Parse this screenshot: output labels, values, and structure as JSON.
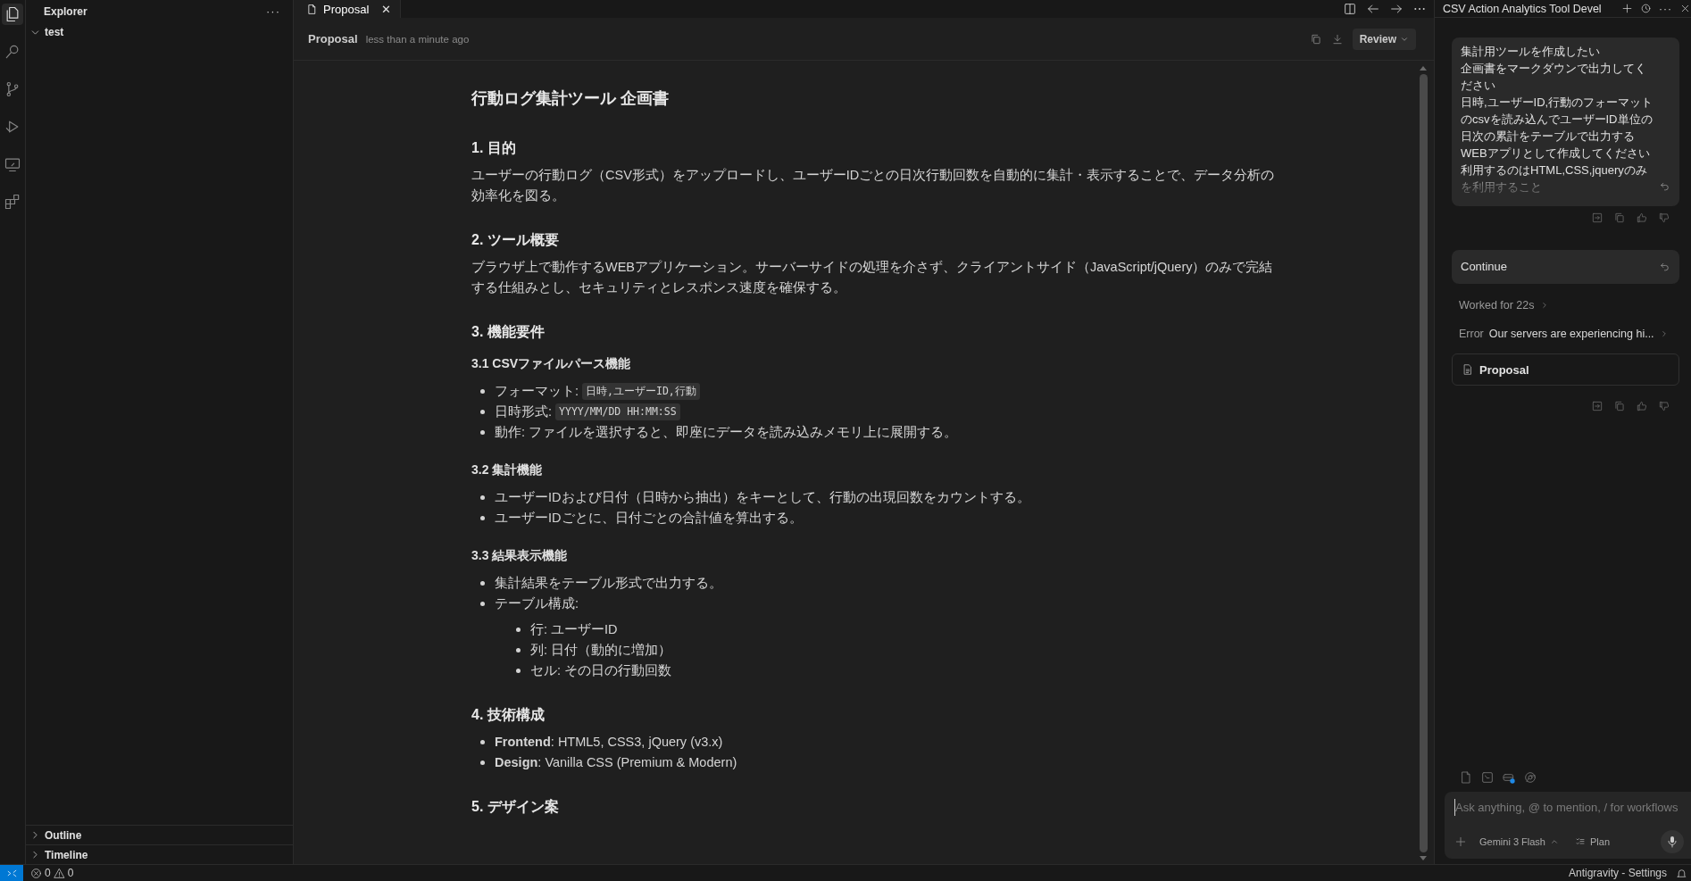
{
  "activity_bar": {
    "items": [
      {
        "kind": "files",
        "selected": true
      },
      {
        "kind": "search",
        "selected": false
      },
      {
        "kind": "branch",
        "selected": false
      },
      {
        "kind": "run",
        "selected": false
      },
      {
        "kind": "remote",
        "selected": false
      },
      {
        "kind": "extensions",
        "selected": false
      }
    ]
  },
  "sidebar": {
    "title": "Explorer",
    "more": "···",
    "folder": {
      "label": "test",
      "expanded": true
    },
    "sections": [
      {
        "label": "Outline",
        "expanded": false
      },
      {
        "label": "Timeline",
        "expanded": false
      }
    ]
  },
  "editor": {
    "tabs": [
      {
        "label": "Proposal",
        "selected": true,
        "close": "✕"
      }
    ],
    "header": {
      "title": "Proposal",
      "subtitle": "less than a minute ago",
      "button": "Review"
    },
    "document": [
      {
        "kind": "h1",
        "text": "行動ログ集計ツール 企画書"
      },
      {
        "kind": "h2",
        "text": "1. 目的"
      },
      {
        "kind": "p",
        "text": "ユーザーの行動ログ（CSV形式）をアップロードし、ユーザーIDごとの日次行動回数を自動的に集計・表示することで、データ分析の効率化を図る。"
      },
      {
        "kind": "h2",
        "text": "2. ツール概要"
      },
      {
        "kind": "p",
        "text": "ブラウザ上で動作するWEBアプリケーション。サーバーサイドの処理を介さず、クライアントサイド（JavaScript/jQuery）のみで完結する仕組みとし、セキュリティとレスポンス速度を確保する。"
      },
      {
        "kind": "h2",
        "text": "3. 機能要件"
      },
      {
        "kind": "h3",
        "text": "3.1 CSVファイルパース機能"
      },
      {
        "kind": "ul",
        "items": [
          {
            "text": "フォーマット: ",
            "code": "日時,ユーザーID,行動"
          },
          {
            "text": "日時形式: ",
            "code": "YYYY/MM/DD HH:MM:SS"
          },
          {
            "text": "動作: ファイルを選択すると、即座にデータを読み込みメモリ上に展開する。"
          }
        ]
      },
      {
        "kind": "h3",
        "text": "3.2 集計機能"
      },
      {
        "kind": "ul",
        "items": [
          {
            "text": "ユーザーIDおよび日付（日時から抽出）をキーとして、行動の出現回数をカウントする。"
          },
          {
            "text": "ユーザーIDごとに、日付ごとの合計値を算出する。"
          }
        ]
      },
      {
        "kind": "h3",
        "text": "3.3 結果表示機能"
      },
      {
        "kind": "ul",
        "items": [
          {
            "text": "集計結果をテーブル形式で出力する。"
          },
          {
            "text": "テーブル構成:",
            "children": [
              {
                "text": "行: ユーザーID"
              },
              {
                "text": "列: 日付（動的に増加）"
              },
              {
                "text": "セル: その日の行動回数"
              }
            ]
          }
        ]
      },
      {
        "kind": "h2",
        "text": "4. 技術構成"
      },
      {
        "kind": "ul",
        "items": [
          {
            "text": "**Frontend**: HTML5, CSS3, jQuery (v3.x)"
          },
          {
            "text": "**Design**: Vanilla CSS (Premium & Modern)"
          }
        ]
      },
      {
        "kind": "h2",
        "text": "5. デザイン案"
      }
    ]
  },
  "agent_panel": {
    "title": "CSV Action Analytics Tool Devel",
    "more": "···",
    "messages": [
      {
        "kind": "user",
        "lines": [
          "集計用ツールを作成したい",
          "企画書をマークダウンで出力してく",
          "ださい",
          "日時,ユーザーID,行動のフォーマット",
          "のcsvを読み込んでユーザーID単位の",
          "日次の累計をテーブルで出力する",
          "WEBアプリとして作成してください",
          "利用するのはHTML,CSS,jqueryのみ",
          "を利用すること"
        ]
      },
      {
        "kind": "user",
        "lines": [
          "Continue"
        ]
      },
      {
        "kind": "status",
        "text": "Worked for 22s"
      },
      {
        "kind": "error",
        "label": "Error",
        "text": "Our servers are experiencing hi..."
      },
      {
        "kind": "artifact",
        "text": "Proposal"
      }
    ],
    "input": {
      "placeholder": "Ask anything, @ to mention, / for workflows",
      "model": "Gemini 3 Flash",
      "mode": "Plan"
    }
  },
  "status_bar": {
    "errors": "0",
    "warnings": "0",
    "right": "Antigravity - Settings"
  }
}
